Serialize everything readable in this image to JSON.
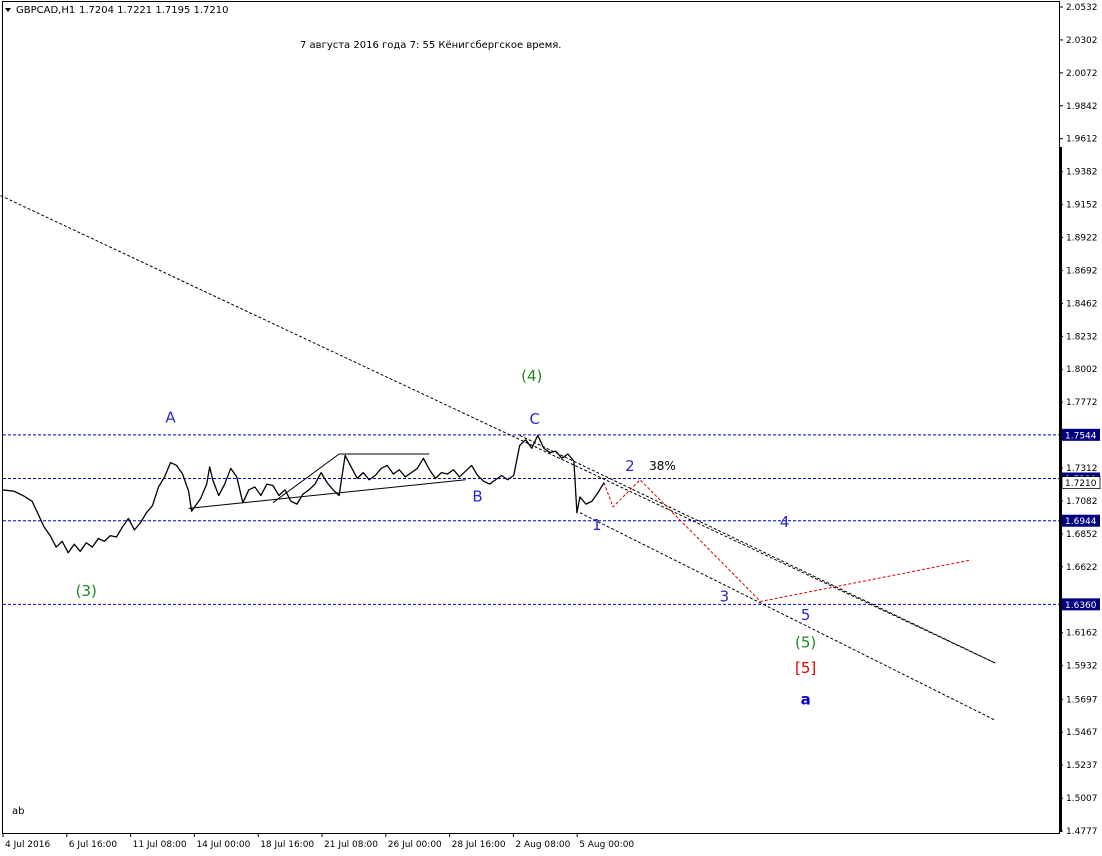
{
  "header": {
    "symbol_caret_icon": "triangle-down-icon",
    "symbol": "GBPCAD,H1",
    "ohlc": "1.7204 1.7221 1.7195 1.7210"
  },
  "annotation": "7 августа 2016 года 7: 55 Кёнигсбергское время.",
  "corner_label": "ab",
  "colors": {
    "price": "#000000",
    "level": "#0000cc",
    "wave_blue": "#2b2bc8",
    "wave_green": "#1f8a1f",
    "wave_red": "#e00000",
    "forecast": "#e00000",
    "axis_box": "#000080"
  },
  "chart_data": {
    "type": "line",
    "title": "",
    "xlabel": "",
    "ylabel": "",
    "ylim": [
      1.4777,
      2.0532
    ],
    "x_tick_labels": [
      "4 Jul 2016",
      "6 Jul 16:00",
      "11 Jul 08:00",
      "14 Jul 00:00",
      "18 Jul 16:00",
      "21 Jul 08:00",
      "26 Jul 00:00",
      "28 Jul 16:00",
      "2 Aug 08:00",
      "5 Aug 00:00"
    ],
    "y_ticks": [
      2.0532,
      2.0302,
      2.0072,
      1.9842,
      1.9612,
      1.9382,
      1.9152,
      1.8922,
      1.8692,
      1.8462,
      1.8232,
      1.8002,
      1.7772,
      1.7542,
      1.7312,
      1.7082,
      1.6852,
      1.6622,
      1.6392,
      1.6162,
      1.5932,
      1.5697,
      1.5467,
      1.5237,
      1.5007,
      1.4777
    ],
    "y_tick_labels": [
      "2.0532",
      "2.0302",
      "2.0072",
      "1.9842",
      "1.9612",
      "1.9382",
      "1.9152",
      "1.8922",
      "1.8692",
      "1.8462",
      "1.8232",
      "1.8002",
      "1.7772",
      "",
      "1.7312",
      "1.7082",
      "1.6852",
      "1.6622",
      "",
      "1.6162",
      "1.5932",
      "1.5697",
      "1.5467",
      "1.5237",
      "1.5007",
      "1.4777"
    ],
    "x_range": [
      0,
      100
    ],
    "series": [
      {
        "values": [
          [
            0,
            1.716
          ],
          [
            2,
            1.715
          ],
          [
            3.5,
            1.712
          ],
          [
            5,
            1.708
          ],
          [
            6,
            1.699
          ],
          [
            7,
            1.69
          ],
          [
            8,
            1.684
          ],
          [
            9,
            1.676
          ],
          [
            10,
            1.68
          ],
          [
            11,
            1.672
          ],
          [
            12,
            1.678
          ],
          [
            13,
            1.673
          ],
          [
            14,
            1.679
          ],
          [
            15,
            1.676
          ],
          [
            16,
            1.682
          ],
          [
            17,
            1.68
          ],
          [
            18,
            1.684
          ],
          [
            19,
            1.683
          ],
          [
            20,
            1.69
          ],
          [
            21,
            1.696
          ],
          [
            22,
            1.688
          ],
          [
            23,
            1.693
          ],
          [
            24,
            1.7
          ],
          [
            25,
            1.705
          ],
          [
            26,
            1.718
          ],
          [
            27,
            1.725
          ],
          [
            28,
            1.735
          ],
          [
            29,
            1.733
          ],
          [
            30,
            1.727
          ],
          [
            31,
            1.715
          ],
          [
            31.5,
            1.701
          ],
          [
            32,
            1.704
          ],
          [
            33,
            1.71
          ],
          [
            34,
            1.72
          ],
          [
            34.5,
            1.732
          ],
          [
            35,
            1.723
          ],
          [
            36,
            1.712
          ],
          [
            37,
            1.72
          ],
          [
            38,
            1.731
          ],
          [
            39,
            1.725
          ],
          [
            40,
            1.707
          ],
          [
            41,
            1.716
          ],
          [
            42,
            1.718
          ],
          [
            43,
            1.712
          ],
          [
            44,
            1.72
          ],
          [
            45,
            1.719
          ],
          [
            46,
            1.712
          ],
          [
            47,
            1.716
          ],
          [
            48,
            1.708
          ],
          [
            49,
            1.706
          ],
          [
            50,
            1.713
          ],
          [
            51,
            1.716
          ],
          [
            52,
            1.72
          ],
          [
            53,
            1.728
          ],
          [
            54,
            1.721
          ],
          [
            55,
            1.716
          ],
          [
            56,
            1.712
          ],
          [
            57,
            1.74
          ],
          [
            58,
            1.732
          ],
          [
            59,
            1.724
          ],
          [
            60,
            1.728
          ],
          [
            61,
            1.723
          ],
          [
            62,
            1.726
          ],
          [
            63,
            1.731
          ],
          [
            64,
            1.733
          ],
          [
            65,
            1.727
          ],
          [
            66,
            1.73
          ],
          [
            67,
            1.725
          ],
          [
            68,
            1.728
          ],
          [
            69,
            1.731
          ],
          [
            70,
            1.738
          ],
          [
            71,
            1.73
          ],
          [
            72,
            1.724
          ],
          [
            73,
            1.728
          ],
          [
            74,
            1.727
          ],
          [
            75,
            1.73
          ],
          [
            76,
            1.725
          ],
          [
            77,
            1.729
          ],
          [
            78,
            1.733
          ],
          [
            79,
            1.726
          ],
          [
            80,
            1.722
          ],
          [
            81,
            1.72
          ],
          [
            82,
            1.723
          ],
          [
            83,
            1.726
          ],
          [
            84,
            1.723
          ],
          [
            85,
            1.726
          ],
          [
            86,
            1.747
          ],
          [
            87,
            1.751
          ],
          [
            88,
            1.745
          ],
          [
            89,
            1.754
          ],
          [
            90,
            1.745
          ],
          [
            91,
            1.742
          ],
          [
            92,
            1.743
          ],
          [
            93,
            1.738
          ],
          [
            94,
            1.741
          ],
          [
            95,
            1.736
          ],
          [
            95.5,
            1.7
          ],
          [
            96,
            1.711
          ],
          [
            97,
            1.706
          ],
          [
            98,
            1.708
          ],
          [
            99,
            1.714
          ],
          [
            100,
            1.721
          ]
        ]
      }
    ],
    "horizontal_levels": [
      {
        "value": 1.7544,
        "label": "1.7544"
      },
      {
        "value": 1.7239,
        "label": "1.7239"
      },
      {
        "value": 1.6944,
        "label": "1.6944"
      },
      {
        "value": 1.636,
        "label": "1.6360"
      }
    ],
    "current_price": {
      "value": 1.721,
      "label": "1.7210"
    },
    "forecast_path": [
      [
        100,
        1.721
      ],
      [
        101.5,
        1.704
      ],
      [
        106,
        1.723
      ],
      [
        126,
        1.638
      ],
      [
        161,
        1.667
      ]
    ],
    "trend_lines": [
      {
        "style": "dashed",
        "from": [
          -1,
          1.923
        ],
        "to": [
          165,
          1.595
        ]
      },
      {
        "style": "dashed",
        "from": [
          96,
          1.7
        ],
        "to": [
          165,
          1.555
        ]
      },
      {
        "style": "dashed",
        "from": [
          86,
          1.754
        ],
        "to": [
          165,
          1.595
        ]
      },
      {
        "style": "solid",
        "from": [
          31,
          1.703
        ],
        "to": [
          77,
          1.723
        ]
      },
      {
        "style": "solid",
        "from": [
          45,
          1.707
        ],
        "to": [
          56,
          1.741
        ]
      },
      {
        "style": "solid",
        "from": [
          56,
          1.741
        ],
        "to": [
          71,
          1.741
        ]
      }
    ],
    "wave_labels": [
      {
        "text": "A",
        "x": 28,
        "y": 1.763,
        "color": "#2b2bc8"
      },
      {
        "text": "(4)",
        "x": 88,
        "y": 1.792,
        "color": "#1f8a1f"
      },
      {
        "text": "C",
        "x": 88.5,
        "y": 1.762,
        "color": "#2b2bc8"
      },
      {
        "text": "B",
        "x": 79,
        "y": 1.708,
        "color": "#2b2bc8"
      },
      {
        "text": "2",
        "x": 104.3,
        "y": 1.729,
        "color": "#2b2bc8"
      },
      {
        "text": "38%",
        "x": 107.5,
        "y": 1.73,
        "color": "#000000",
        "small": true
      },
      {
        "text": "1",
        "x": 98.8,
        "y": 1.688,
        "color": "#2b2bc8"
      },
      {
        "text": "4",
        "x": 130,
        "y": 1.69,
        "color": "#2b2bc8"
      },
      {
        "text": "(3)",
        "x": 14,
        "y": 1.642,
        "color": "#1f8a1f"
      },
      {
        "text": "3",
        "x": 120,
        "y": 1.638,
        "color": "#2b2bc8"
      },
      {
        "text": "5",
        "x": 133.5,
        "y": 1.625,
        "color": "#2b2bc8"
      },
      {
        "text": "(5)",
        "x": 133.5,
        "y": 1.606,
        "color": "#1f8a1f"
      },
      {
        "text": "[5]",
        "x": 133.5,
        "y": 1.588,
        "color": "#e00000"
      },
      {
        "text": "a",
        "x": 133.5,
        "y": 1.566,
        "color": "#0000cc",
        "bold": true
      }
    ]
  }
}
